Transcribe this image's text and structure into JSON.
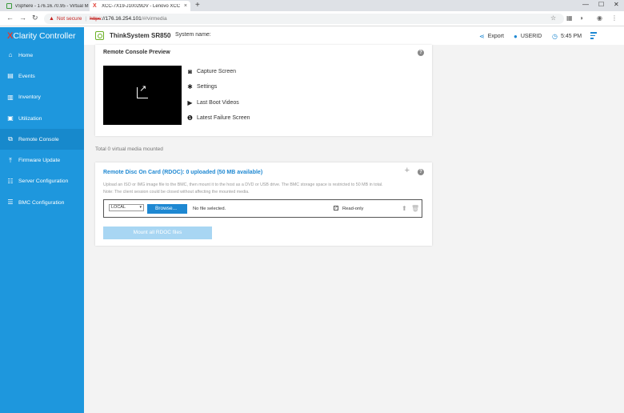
{
  "browser": {
    "tabs": [
      {
        "title": "vSphere - 176.16.70.95 - Virtual M"
      },
      {
        "title": "XCC-7X19-J10029DV - Lenovo XCC"
      }
    ],
    "url": {
      "security": "Not secure",
      "scheme": "https",
      "host": "://176.16.254.101",
      "path": "/#/virmedia"
    }
  },
  "header": {
    "brand_x": "X",
    "brand_rest": "Clarity Controller",
    "product": "ThinkSystem SR850",
    "system_name_label": "System name:",
    "export_label": "Export",
    "user_label": "USERID",
    "time": "5:45 PM"
  },
  "sidebar": {
    "items": [
      {
        "label": "Home",
        "icon": "home-icon"
      },
      {
        "label": "Events",
        "icon": "events-icon"
      },
      {
        "label": "Inventory",
        "icon": "inventory-icon"
      },
      {
        "label": "Utilization",
        "icon": "utilization-icon"
      },
      {
        "label": "Remote Console",
        "icon": "remote-console-icon"
      },
      {
        "label": "Firmware Update",
        "icon": "firmware-icon"
      },
      {
        "label": "Server Configuration",
        "icon": "server-config-icon"
      },
      {
        "label": "BMC Configuration",
        "icon": "bmc-config-icon"
      }
    ]
  },
  "preview": {
    "title": "Remote Console Preview",
    "actions": [
      {
        "label": "Capture Screen",
        "icon": "camera-icon"
      },
      {
        "label": "Settings",
        "icon": "gear-icon"
      },
      {
        "label": "Last Boot Videos",
        "icon": "play-icon"
      },
      {
        "label": "Latest Failure Screen",
        "icon": "alert-icon"
      }
    ]
  },
  "media": {
    "count_text": "Total 0 virtual media mounted",
    "rdoc_title": "Remote Disc On Card (RDOC): 0 uploaded (50 MB available)",
    "desc_line1": "Upload an ISO or IMG image file to the BMC, then mount it to the host as a DVD or USB drive. The BMC storage space is restricted to 50 MB in total.",
    "desc_line2": "Note: The client session could be closed without affecting the mounted media.",
    "source_value": "LOCAL",
    "browse_label": "Browse...",
    "no_file": "No file selected.",
    "readonly_label": "Read-only",
    "mount_label": "Mount all RDOC files"
  },
  "colors": {
    "sidebar": "#1e97dd",
    "accent": "#1e88d2",
    "brand_x": "#e03a2f"
  }
}
